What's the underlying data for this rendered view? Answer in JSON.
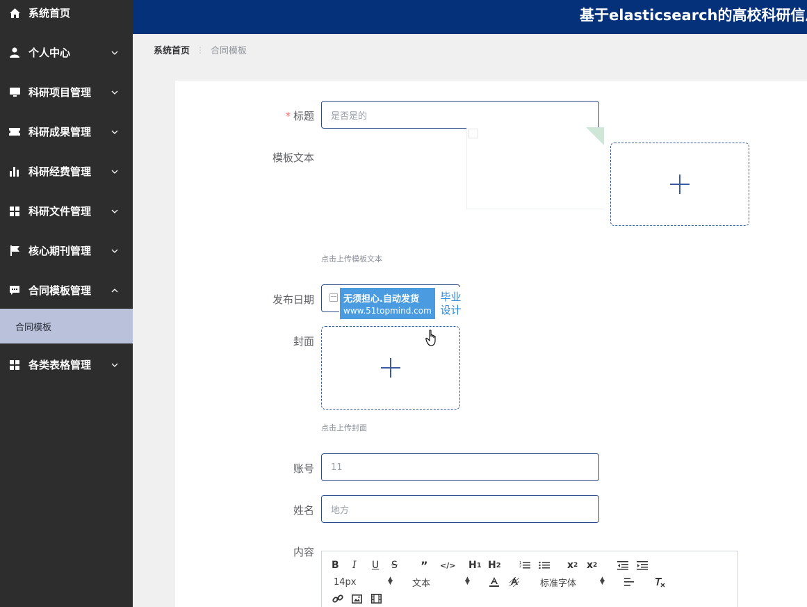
{
  "header": {
    "title": "基于elasticsearch的高校科研信息"
  },
  "sidebar": {
    "items": [
      {
        "label": "系统首页",
        "icon": "home-icon"
      },
      {
        "label": "个人中心",
        "icon": "user-icon"
      },
      {
        "label": "科研项目管理",
        "icon": "monitor-icon"
      },
      {
        "label": "科研成果管理",
        "icon": "ticket-icon"
      },
      {
        "label": "科研经费管理",
        "icon": "bar-chart-icon"
      },
      {
        "label": "科研文件管理",
        "icon": "grid-icon"
      },
      {
        "label": "核心期刊管理",
        "icon": "flag-icon"
      },
      {
        "label": "合同模板管理",
        "icon": "chat-icon"
      },
      {
        "label": "各类表格管理",
        "icon": "grid-icon"
      }
    ],
    "subitem": {
      "label": "合同模板"
    },
    "active_color": "#b9c2da",
    "bg_color": "#2d2d2d"
  },
  "breadcrumb": {
    "home": "系统首页",
    "current": "合同模板"
  },
  "form": {
    "title": {
      "label": "标题",
      "value": "是否是的"
    },
    "template_text": {
      "label": "模板文本",
      "hint": "点击上传模板文本"
    },
    "publish_date": {
      "label": "发布日期"
    },
    "cover": {
      "label": "封面",
      "hint": "点击上传封面"
    },
    "account": {
      "label": "账号",
      "value": "11"
    },
    "name": {
      "label": "姓名",
      "value": "地方"
    },
    "content": {
      "label": "内容"
    }
  },
  "editor": {
    "font_size": "14px",
    "text_style": "文本",
    "font_family": "标准字体"
  },
  "watermark": {
    "line1": "无须担心.自动发货",
    "line2": "www.51topmind.com",
    "right1": "毕业",
    "right2": "设计"
  },
  "colors": {
    "header": "#05317b",
    "accent": "#3a5aa0",
    "required": "#f56c6c"
  }
}
